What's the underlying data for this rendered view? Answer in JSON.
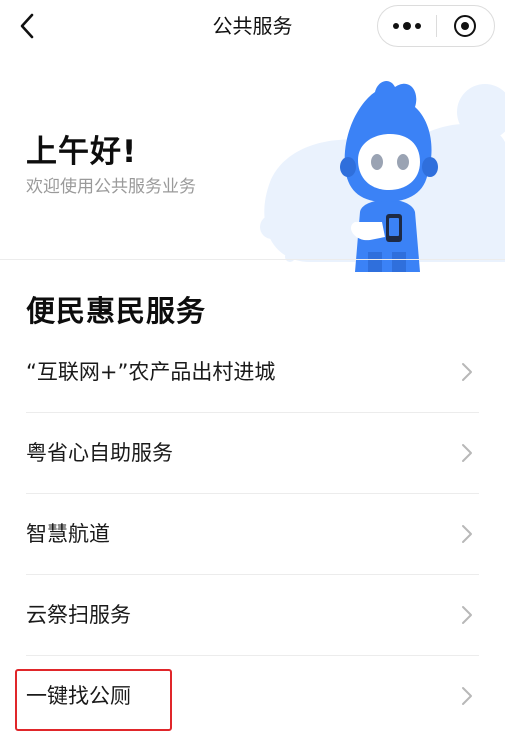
{
  "header": {
    "title": "公共服务",
    "back_icon": "back-arrow-icon",
    "more_icon": "more-dots-icon",
    "close_icon": "target-circle-icon"
  },
  "banner": {
    "greeting": "上午好!",
    "subtitle": "欢迎使用公共服务业务",
    "illustration": "mascot-robot-illustration"
  },
  "section": {
    "title": "便民惠民服务",
    "items": [
      {
        "label": "“互联网+”农产品出村进城"
      },
      {
        "label": "粤省心自助服务"
      },
      {
        "label": "智慧航道"
      },
      {
        "label": "云祭扫服务"
      },
      {
        "label": "一键找公厕"
      }
    ]
  },
  "colors": {
    "accent_blue": "#3b82f6",
    "highlight_red": "#e0262a",
    "subtitle_gray": "#9a9a9a",
    "divider": "#ececec"
  }
}
